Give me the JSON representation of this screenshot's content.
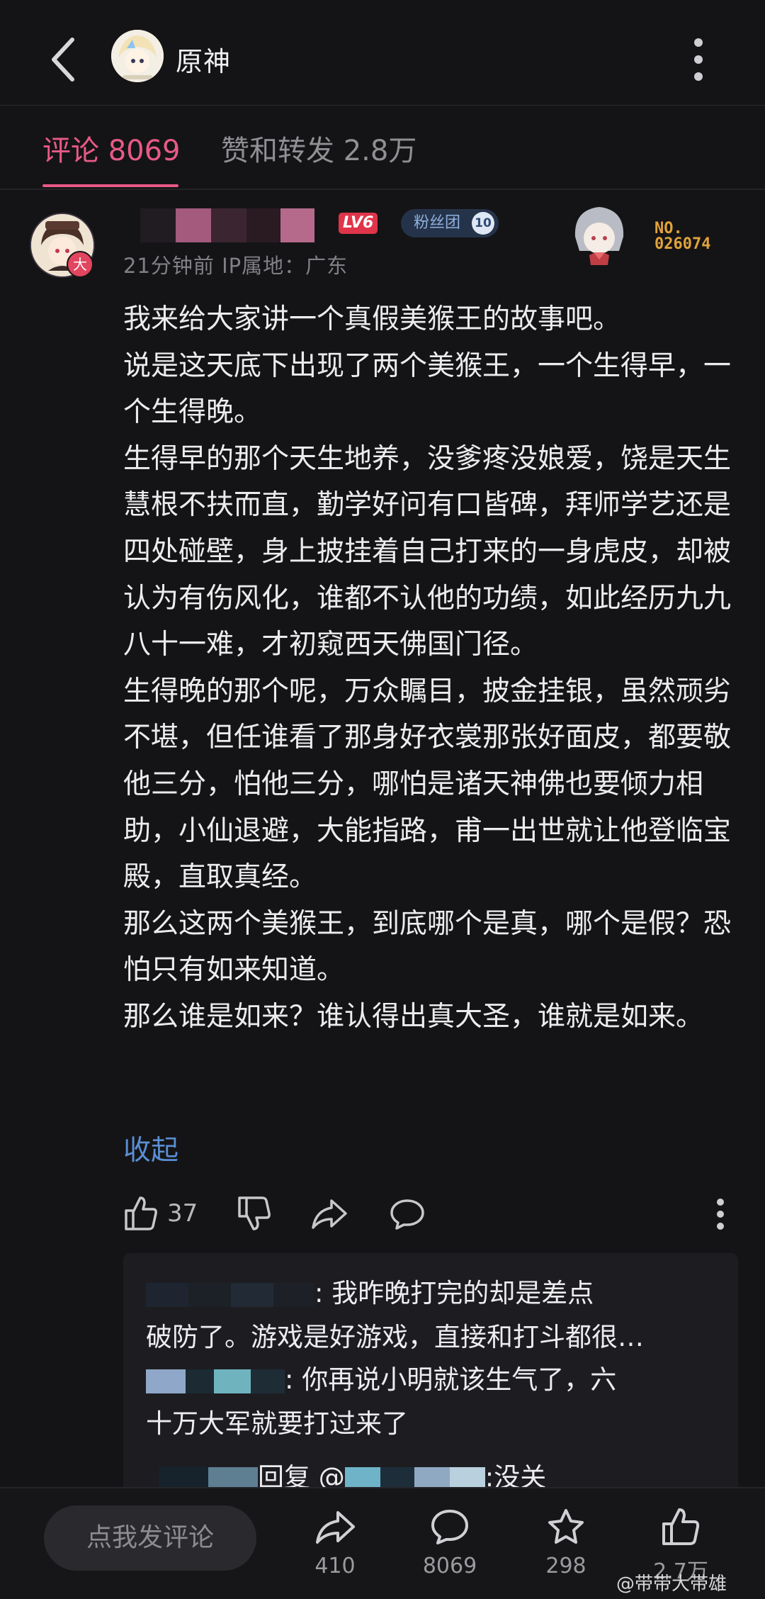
{
  "header": {
    "back_label": "back",
    "title": "原神"
  },
  "tabs": {
    "comments": "评论 8069",
    "likes_shares": "赞和转发 2.8万"
  },
  "comment": {
    "avatar_badge": "大",
    "level_badge": "LV6",
    "fan_club_label": "粉丝团",
    "fan_club_level": "10",
    "meta": "21分钟前  IP属地：广东",
    "deco_number_line1": "NO.",
    "deco_number_line2": "026074",
    "paragraphs": [
      "我来给大家讲一个真假美猴王的故事吧。",
      "说是这天底下出现了两个美猴王，一个生得早，一个生得晚。",
      "生得早的那个天生地养，没爹疼没娘爱，饶是天生慧根不扶而直，勤学好问有口皆碑，拜师学艺还是四处碰壁，身上披挂着自己打来的一身虎皮，却被认为有伤风化，谁都不认他的功绩，如此经历九九八十一难，才初窥西天佛国门径。",
      "生得晚的那个呢，万众瞩目，披金挂银，虽然顽劣不堪，但任谁看了那身好衣裳那张好面皮，都要敬他三分，怕他三分，哪怕是诸天神佛也要倾力相助，小仙退避，大能指路，甫一出世就让他登临宝殿，直取真经。",
      "那么这两个美猴王，到底哪个是真，哪个是假？恐怕只有如来知道。",
      "那么谁是如来？谁认得出真大圣，谁就是如来。"
    ],
    "collapse_label": "收起",
    "like_count": "37",
    "icons": {
      "like": "thumbs-up-icon",
      "dislike": "thumbs-down-icon",
      "share": "share-icon",
      "reply": "comment-icon",
      "more": "more-vertical-icon"
    }
  },
  "replies": [
    {
      "text_line1": ": 我昨晚打完的却是差点",
      "text_line2": "破防了。游戏是好游戏，直接和打斗都很…"
    },
    {
      "text_line1": ": 你再说小明就该生气了，六",
      "text_line2": "十万大军就要打过来了"
    },
    {
      "prefix": "回复 @",
      "text": ":没关"
    }
  ],
  "bottom_bar": {
    "input_placeholder": "点我发评论",
    "share_count": "410",
    "comment_count": "8069",
    "favorite_count": "298",
    "like_count": "2.7万"
  },
  "watermark": "@带带大带雄",
  "colors": {
    "accent": "#e85a86",
    "link": "#5b8ed4",
    "background": "#141416"
  }
}
